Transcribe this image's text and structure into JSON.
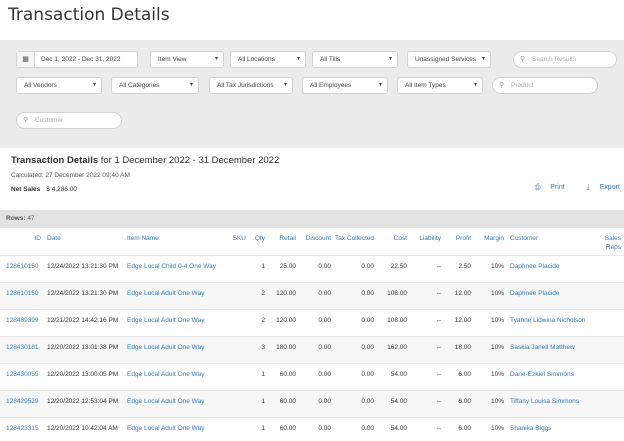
{
  "page_title": "Transaction Details",
  "filters": {
    "date_range": "Dec 1, 2022 - Dec 31, 2022",
    "row1": [
      "Item View",
      "All Locations",
      "All Tills",
      "Unassigned Services"
    ],
    "search_results_placeholder": "Search Results",
    "row2": [
      "All Vendors",
      "All Categories",
      "All Tax Jurisdictions",
      "All Employees",
      "All Item Types"
    ],
    "product_placeholder": "Product",
    "customer_placeholder": "Customer"
  },
  "summary": {
    "title_bold": "Transaction Details",
    "title_rest": " for 1 December 2022 - 31 December 2022",
    "calculated": "Calculated: 27 December 2022 09:40 AM",
    "net_sales_label": "Net Sales",
    "net_sales_value": "$ 4,286.00"
  },
  "actions": {
    "print": "Print",
    "export": "Export"
  },
  "rows_label": "Rows:",
  "rows_count": "47",
  "columns": [
    "ID",
    "Date",
    "Item Name",
    "SKU",
    "Qty",
    "Retail",
    "Discount",
    "Tax Collected",
    "Cost",
    "Liability",
    "Profit",
    "Margin",
    "Customer",
    "Sales Reps"
  ],
  "rows": [
    {
      "id": "128610150",
      "date": "12/24/2022 13:21:30 PM",
      "item": "Edge Local Child 0-4 One Way",
      "sku": "",
      "qty": "1",
      "retail": "25.00",
      "discount": "0.00",
      "tax": "0.00",
      "cost": "22.50",
      "liability": "--",
      "profit": "2.50",
      "margin": "10%",
      "customer": "Daphnee Placide",
      "reps": ""
    },
    {
      "id": "128610150",
      "date": "12/24/2022 13:21:30 PM",
      "item": "Edge Local Adult One Way",
      "sku": "",
      "qty": "2",
      "retail": "120.00",
      "discount": "0.00",
      "tax": "0.00",
      "cost": "108.00",
      "liability": "--",
      "profit": "12.00",
      "margin": "10%",
      "customer": "Daphnee Placide",
      "reps": ""
    },
    {
      "id": "128489399",
      "date": "12/21/2022 14:42:16 PM",
      "item": "Edge Local Adult One Way",
      "sku": "",
      "qty": "2",
      "retail": "120.00",
      "discount": "0.00",
      "tax": "0.00",
      "cost": "108.00",
      "liability": "--",
      "profit": "12.00",
      "margin": "10%",
      "customer": "Tyanne Lidwina Nicholson",
      "reps": ""
    },
    {
      "id": "128430181",
      "date": "12/20/2022 13:01:38 PM",
      "item": "Edge Local Adult One Way",
      "sku": "",
      "qty": "3",
      "retail": "180.00",
      "discount": "0.00",
      "tax": "0.00",
      "cost": "162.00",
      "liability": "--",
      "profit": "18.00",
      "margin": "10%",
      "customer": "Saskia Janell Matthew",
      "reps": ""
    },
    {
      "id": "128430055",
      "date": "12/20/2022 13:00:05 PM",
      "item": "Edge Local Adult One Way",
      "sku": "",
      "qty": "1",
      "retail": "60.00",
      "discount": "0.00",
      "tax": "0.00",
      "cost": "54.00",
      "liability": "--",
      "profit": "6.00",
      "margin": "10%",
      "customer": "Dane-Ezkiel Simmons",
      "reps": ""
    },
    {
      "id": "128429529",
      "date": "12/20/2022 12:53:04 PM",
      "item": "Edge Local Adult One Way",
      "sku": "",
      "qty": "1",
      "retail": "60.00",
      "discount": "0.00",
      "tax": "0.00",
      "cost": "54.00",
      "liability": "--",
      "profit": "6.00",
      "margin": "10%",
      "customer": "Tiffany Louisa Simmons",
      "reps": ""
    },
    {
      "id": "128423315",
      "date": "12/20/2022 10:42:04 AM",
      "item": "Edge Local Adult One Way",
      "sku": "",
      "qty": "1",
      "retail": "60.00",
      "discount": "0.00",
      "tax": "0.00",
      "cost": "54.00",
      "liability": "--",
      "profit": "6.00",
      "margin": "10%",
      "customer": "Shanika Biggs",
      "reps": ""
    }
  ],
  "icons": {
    "calendar": "calendar-icon",
    "search": "search-icon",
    "chevron": "chevron-down-icon",
    "print": "print-icon",
    "export": "export-icon"
  },
  "colors": {
    "link": "#337ab7",
    "filter_bg": "#ececec",
    "rows_bar": "#e3e3e3"
  }
}
